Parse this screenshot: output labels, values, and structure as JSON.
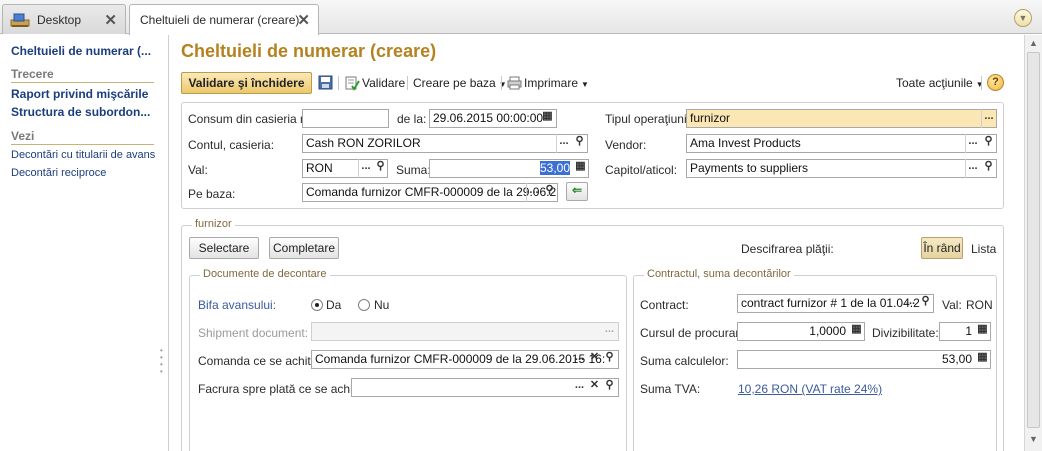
{
  "tabs": [
    {
      "label": "Desktop",
      "icon": "desktop-icon"
    },
    {
      "label": "Cheltuieli de numerar (creare)"
    }
  ],
  "left_panel": {
    "current": "Cheltuieli de numerar (...",
    "section_trecere": "Trecere",
    "trecere_links": [
      "Raport privind mişcările",
      "Structura de subordon..."
    ],
    "section_vezi": "Vezi",
    "vezi_links": [
      "Decontări cu titularii de avans",
      "Decontări reciproce"
    ]
  },
  "page": {
    "title": "Cheltuieli de numerar (creare)",
    "accent_color": "#b4821f"
  },
  "toolbar": {
    "post_close": "Validare şi închidere",
    "post": "Validare",
    "create_based": "Creare pe baza",
    "print": "Imprimare",
    "all_actions": "Toate acţiunile",
    "help": "?"
  },
  "header": {
    "consum_label": "Consum din casieria nr.:",
    "consum_value": "",
    "date_label": "de la:",
    "date_value": "29.06.2015 00:00:00",
    "op_type_label": "Tipul operaţiunii:",
    "op_type_value": "furnizor",
    "account_label": "Contul, casieria:",
    "account_value": "Cash RON ZORILOR",
    "vendor_label": "Vendor:",
    "vendor_value": "Ama Invest Products",
    "currency_label": "Val:",
    "currency_value": "RON",
    "sum_label": "Suma:",
    "sum_value": "53,00",
    "chapter_label": "Capitol/aticol:",
    "chapter_value": "Payments to suppliers",
    "basis_label": "Pe baza:",
    "basis_value": "Comanda furnizor CMFR-000009 de la 29.06.2"
  },
  "supplier_group": {
    "label": "furnizor",
    "select_btn": "Selectare",
    "fill_btn": "Completare",
    "breakdown_label": "Descifrarea plăţii:",
    "in_row": "În rând",
    "list": "Lista"
  },
  "settlement_docs": {
    "label": "Documente de decontare",
    "advance_label": "Bifa avansului:",
    "yes": "Da",
    "no": "Nu",
    "advance_selected": "Da",
    "shipment_label": "Shipment document:",
    "shipment_value": "",
    "order_label": "Comanda ce se achită:",
    "order_value": "Comanda furnizor CMFR-000009 de la 29.06.2015 16:",
    "invoice_label": "Facrura spre plată ce se achită:",
    "invoice_value": ""
  },
  "contract_block": {
    "label": "Contractul, suma decontărilor",
    "contract_label": "Contract:",
    "contract_value": "contract furnizor # 1 de la 01.04.2",
    "val_label": "Val:",
    "val_value": "RON",
    "rate_label": "Cursul de procurare:",
    "rate_value": "1,0000",
    "div_label": "Divizibilitate:",
    "div_value": "1",
    "calc_sum_label": "Suma calculelor:",
    "calc_sum_value": "53,00",
    "vat_label": "Suma TVA:",
    "vat_value": "10,26 RON (VAT rate 24%)"
  }
}
